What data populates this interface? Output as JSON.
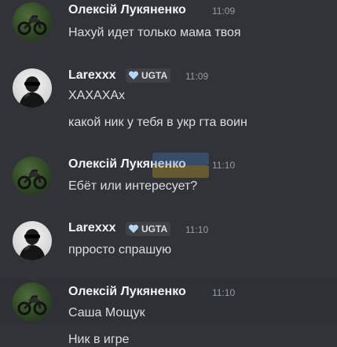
{
  "messages": [
    {
      "author": "Олексій Лукяненко",
      "avatar": "motorcycle-avatar",
      "time": "11:09",
      "lines": [
        "Нахуй идет только мама твоя"
      ]
    },
    {
      "author": "Larexxx",
      "avatar": "person-avatar",
      "tag": "UGTA",
      "tag_icon": "heart-icon",
      "time": "11:09",
      "lines": [
        "ХАХАХАх",
        "какой ник у тебя в укр гта воин"
      ]
    },
    {
      "author": "Олексій Лукяненко",
      "avatar": "motorcycle-avatar",
      "time": "11:10",
      "lines": [
        "Ебёт или интересует?"
      ]
    },
    {
      "author": "Larexxx",
      "avatar": "person-avatar",
      "tag": "UGTA",
      "tag_icon": "heart-icon",
      "time": "11:10",
      "lines": [
        "прросто спрашую"
      ]
    },
    {
      "author": "Олексій Лукяненко",
      "avatar": "motorcycle-avatar",
      "time": "11:10",
      "lines": [
        "Саша Мощук",
        "Ник в игре"
      ]
    }
  ],
  "colors": {
    "background": "#313338",
    "hover_background": "#2e3035",
    "username": "#f2f3f5",
    "message_text": "#dbdee1",
    "timestamp": "#949ba4",
    "tag_background": "#3f4147",
    "tag_heart": "#b5d7f5"
  }
}
